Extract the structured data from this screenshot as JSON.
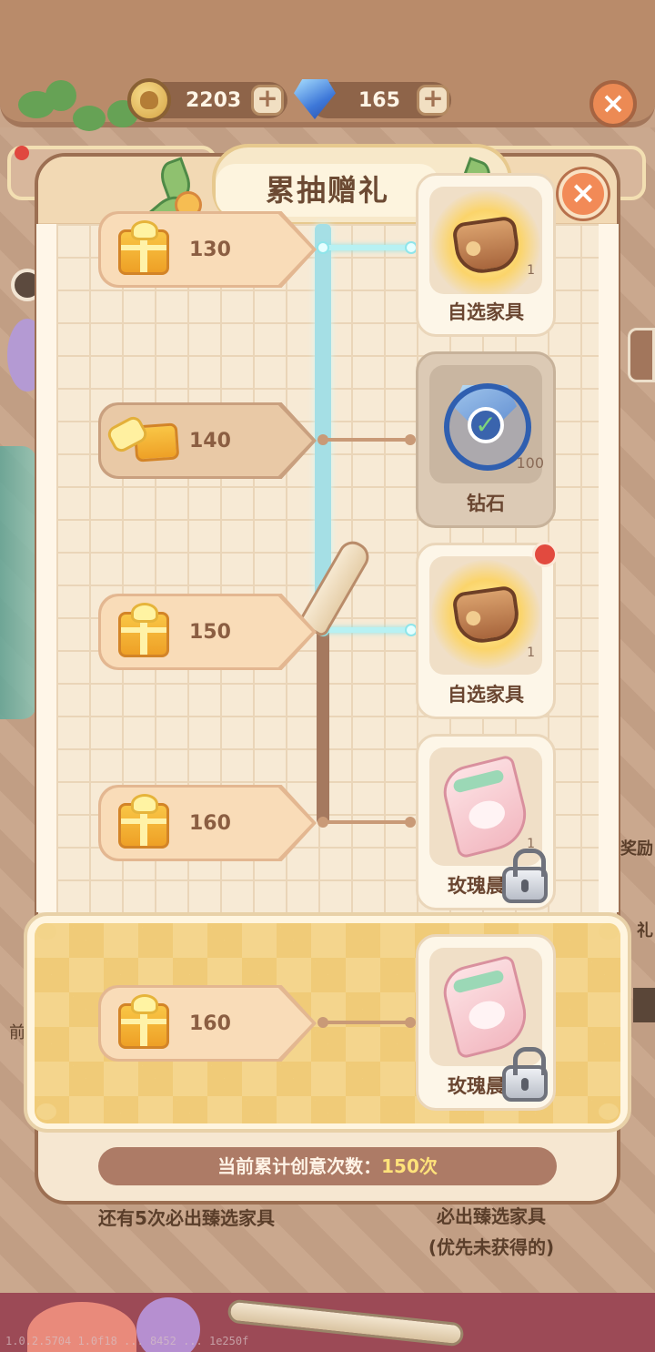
{
  "hud": {
    "coins": "2203",
    "gems": "165"
  },
  "modal": {
    "title": "累抽赠礼"
  },
  "milestones": [
    {
      "count": "130",
      "reward_label": "自选家具",
      "reward_qty": "1"
    },
    {
      "count": "140",
      "reward_label": "钻石",
      "reward_qty": "100"
    },
    {
      "count": "150",
      "reward_label": "自选家具",
      "reward_qty": "1"
    },
    {
      "count": "160",
      "reward_label": "玫瑰晨曦",
      "reward_qty": "1"
    }
  ],
  "final_milestone": {
    "count": "160",
    "reward_label": "玫瑰晨曦"
  },
  "progress": {
    "prefix": "当前累计创意次数：",
    "value": "150次"
  },
  "background": {
    "left_hint": "还有5次必出臻选家具",
    "right_hint_line1": "必出臻选家具",
    "right_hint_line2": "(优先未获得的)",
    "side_label_1": "奖励",
    "side_label_2": "礼",
    "side_label_3": "前",
    "debug_text": "1.0.2.5704 1.0f18 ... 8452 ... 1e250f"
  }
}
